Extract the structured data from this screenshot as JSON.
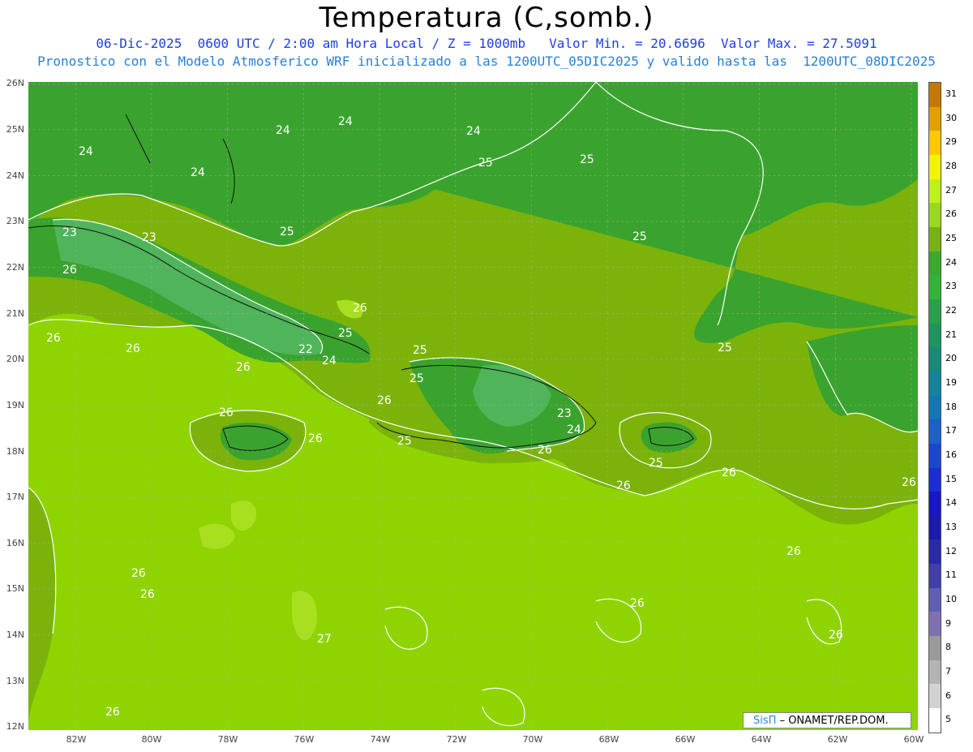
{
  "header": {
    "title": "Temperatura (C,somb.)",
    "subtitle1": "06-Dic-2025  0600 UTC / 2:00 am Hora Local / Z = 1000mb   Valor Min. = 20.6696  Valor Max. = 27.5091",
    "subtitle2": "Pronostico con el Modelo Atmosferico WRF inicializado a las 1200UTC_05DIC2025 y valido hasta las  1200UTC_08DIC2025"
  },
  "axes": {
    "y_labels": [
      "26N",
      "25N",
      "24N",
      "23N",
      "22N",
      "21N",
      "20N",
      "19N",
      "18N",
      "17N",
      "16N",
      "15N",
      "14N",
      "13N",
      "12N"
    ],
    "x_labels": [
      "82W",
      "80W",
      "78W",
      "76W",
      "74W",
      "72W",
      "70W",
      "68W",
      "66W",
      "64W",
      "62W",
      "60W"
    ]
  },
  "contour_labels": [
    {
      "text": "24"
    },
    {
      "text": "24"
    },
    {
      "text": "24"
    },
    {
      "text": "24"
    },
    {
      "text": "24"
    },
    {
      "text": "25"
    },
    {
      "text": "25"
    },
    {
      "text": "25"
    },
    {
      "text": "23"
    },
    {
      "text": "23"
    },
    {
      "text": "25"
    },
    {
      "text": "26"
    },
    {
      "text": "26"
    },
    {
      "text": "25"
    },
    {
      "text": "22"
    },
    {
      "text": "24"
    },
    {
      "text": "26"
    },
    {
      "text": "26"
    },
    {
      "text": "26"
    },
    {
      "text": "25"
    },
    {
      "text": "23"
    },
    {
      "text": "24"
    },
    {
      "text": "25"
    },
    {
      "text": "26"
    },
    {
      "text": "26"
    },
    {
      "text": "25"
    },
    {
      "text": "26"
    },
    {
      "text": "26"
    },
    {
      "text": "26"
    },
    {
      "text": "26"
    },
    {
      "text": "26"
    },
    {
      "text": "26"
    },
    {
      "text": "26"
    },
    {
      "text": "27"
    },
    {
      "text": "26"
    },
    {
      "text": "26"
    },
    {
      "text": "25"
    },
    {
      "text": "25"
    },
    {
      "text": "26"
    },
    {
      "text": "26"
    }
  ],
  "colorbar": {
    "labels": [
      "31",
      "30",
      "29",
      "28",
      "27",
      "26",
      "25",
      "24",
      "23",
      "22",
      "21",
      "20",
      "19",
      "18",
      "17",
      "16",
      "15",
      "14",
      "13",
      "12",
      "11",
      "10",
      "9",
      "8",
      "7",
      "6",
      "5"
    ],
    "colors": [
      "#c07a00",
      "#e0a000",
      "#ffc800",
      "#f2f20a",
      "#bff01a",
      "#9ad81a",
      "#78b212",
      "#3ca830",
      "#33b33c",
      "#2aa04a",
      "#1f9460",
      "#178a78",
      "#14849a",
      "#1476b4",
      "#1e5fc8",
      "#1c46d2",
      "#1a2ed8",
      "#1818c8",
      "#1a1ab0",
      "#2a2aa8",
      "#4040a8",
      "#6060b0",
      "#8070b0",
      "#9a9a9a",
      "#b4b4b4",
      "#d2d2d2",
      "#ffffff"
    ]
  },
  "credit": {
    "brand": "SisΠ",
    "rest": "– ONAMET/REP.DOM."
  }
}
